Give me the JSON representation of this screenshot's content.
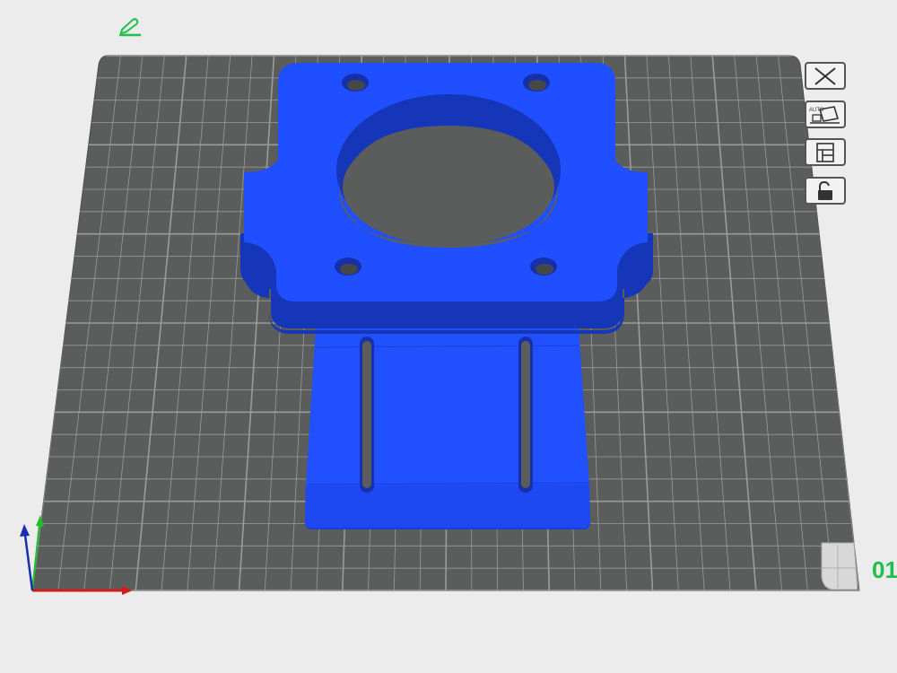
{
  "app": {
    "plate_label": "01"
  },
  "toolbar": {
    "edit_icon": "pencil-icon",
    "buttons": [
      {
        "icon": "close-icon"
      },
      {
        "icon": "auto-arrange-icon",
        "text": "AUTO"
      },
      {
        "icon": "layout-icon"
      },
      {
        "icon": "lock-icon"
      }
    ]
  },
  "scene": {
    "plate_color": "#5b5d5c",
    "grid_color": "#9a9c9b",
    "model_color": "#1f4fff",
    "model_shadow_color": "#1536b8",
    "axis_colors": {
      "x": "#d01c1c",
      "y": "#1fbf2a",
      "z": "#1a2fb0"
    }
  }
}
